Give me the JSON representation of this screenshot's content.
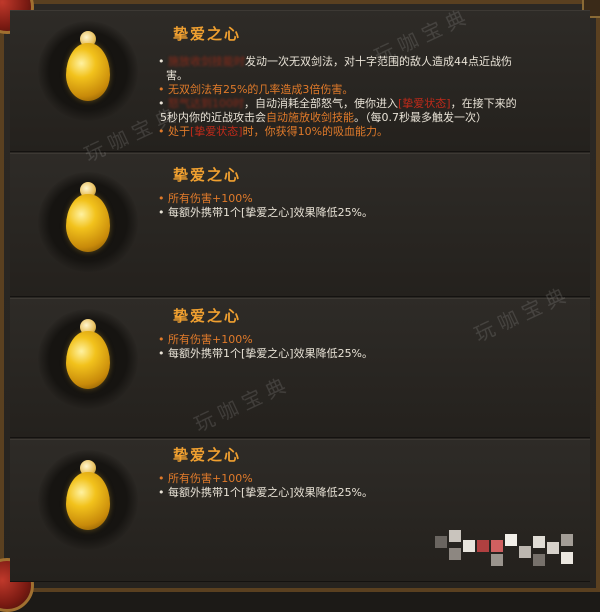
{
  "watermark": "玩咖宝典",
  "cards": [
    {
      "title": "挚爱之心",
      "icon": "golden-heart-icon",
      "lines": [
        {
          "segments": [
            {
              "t": "• ",
              "c": "white"
            },
            {
              "t": "施放收剑技能时",
              "c": "blur"
            },
            {
              "t": "发动一次无双剑法，对十字范围的敌人造成44点近战伤",
              "c": "white"
            }
          ]
        },
        {
          "segments": [
            {
              "t": "害。",
              "c": "white"
            }
          ]
        },
        {
          "segments": [
            {
              "t": "• 无双剑法有25%的几率造成3倍伤害。",
              "c": "orange"
            }
          ]
        },
        {
          "segments": [
            {
              "t": "• ",
              "c": "white"
            },
            {
              "t": "怒气达到100时",
              "c": "blur"
            },
            {
              "t": "，自动消耗全部怒气，使你进入",
              "c": "white"
            },
            {
              "t": "[挚爱状态]",
              "c": "red"
            },
            {
              "t": "，在接下来的",
              "c": "white"
            }
          ]
        },
        {
          "segments": [
            {
              "t": "5秒内你的近战攻击会",
              "c": "white"
            },
            {
              "t": "自动施放收剑技能",
              "c": "orange"
            },
            {
              "t": "。（每0.7秒最多触发一次）",
              "c": "white"
            }
          ]
        },
        {
          "segments": [
            {
              "t": "• 处于",
              "c": "orange"
            },
            {
              "t": "[挚爱状态]",
              "c": "red"
            },
            {
              "t": "时，你获得10%的吸血能力。",
              "c": "orange"
            }
          ]
        }
      ]
    },
    {
      "title": "挚爱之心",
      "icon": "golden-heart-icon",
      "lines": [
        {
          "segments": [
            {
              "t": "• 所有伤害+100%",
              "c": "orange"
            }
          ]
        },
        {
          "segments": [
            {
              "t": "• 每额外携带1个[挚爱之心]效果降低25%。",
              "c": "white"
            }
          ]
        }
      ]
    },
    {
      "title": "挚爱之心",
      "icon": "golden-heart-icon",
      "lines": [
        {
          "segments": [
            {
              "t": "• 所有伤害+100%",
              "c": "orange"
            }
          ]
        },
        {
          "segments": [
            {
              "t": "• 每额外携带1个[挚爱之心]效果降低25%。",
              "c": "white"
            }
          ]
        }
      ]
    },
    {
      "title": "挚爱之心",
      "icon": "golden-heart-icon",
      "lines": [
        {
          "segments": [
            {
              "t": "• 所有伤害+100%",
              "c": "orange"
            }
          ]
        },
        {
          "segments": [
            {
              "t": "• 每额外携带1个[挚爱之心]效果降低25%。",
              "c": "white"
            }
          ]
        }
      ]
    }
  ]
}
